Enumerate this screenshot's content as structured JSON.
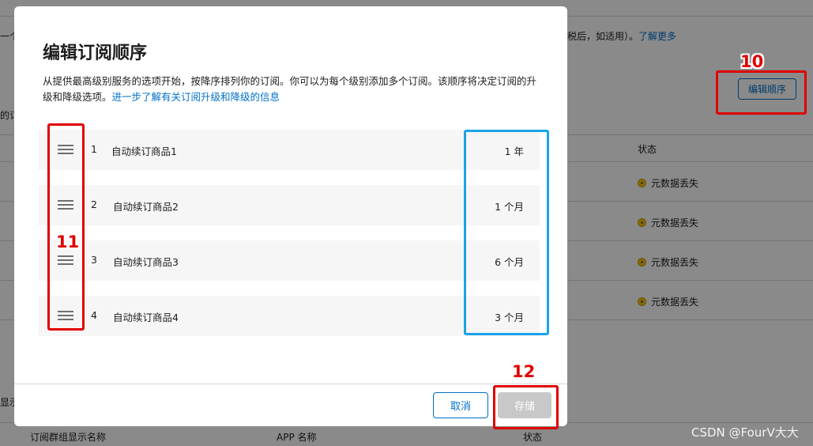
{
  "background": {
    "top_left_fragment": "一个",
    "top_right_text": "税后，如适用）。",
    "learn_more": "了解更多",
    "edit_order_button": "编辑顺序",
    "left_fragment": "的订",
    "left_fragment2": "显示",
    "status_header": "状态",
    "status_rows": [
      "元数据丢失",
      "元数据丢失",
      "元数据丢失",
      "元数据丢失"
    ],
    "footer_headers": {
      "group_name": "订阅群组显示名称",
      "app_name": "APP 名称",
      "status": "状态"
    }
  },
  "modal": {
    "title": "编辑订阅顺序",
    "description": "从提供最高级别服务的选项开始，按降序排列你的订阅。你可以为每个级别添加多个订阅。该顺序将决定订阅的升级和降级选项。",
    "description_link": "进一步了解有关订阅升级和降级的信息",
    "rows": [
      {
        "index": "1",
        "name": "自动续订商品1",
        "duration": "1 年"
      },
      {
        "index": "2",
        "name": "自动续订商品2",
        "duration": "1 个月"
      },
      {
        "index": "3",
        "name": "自动续订商品3",
        "duration": "6 个月"
      },
      {
        "index": "4",
        "name": "自动续订商品4",
        "duration": "3 个月"
      }
    ],
    "cancel_button": "取消",
    "save_button": "存储"
  },
  "annotations": {
    "label_10": "10",
    "label_11": "11",
    "label_12": "12",
    "color_red": "#e00000",
    "color_blue": "#1aa3e8"
  },
  "watermark": "CSDN @FourV大大"
}
